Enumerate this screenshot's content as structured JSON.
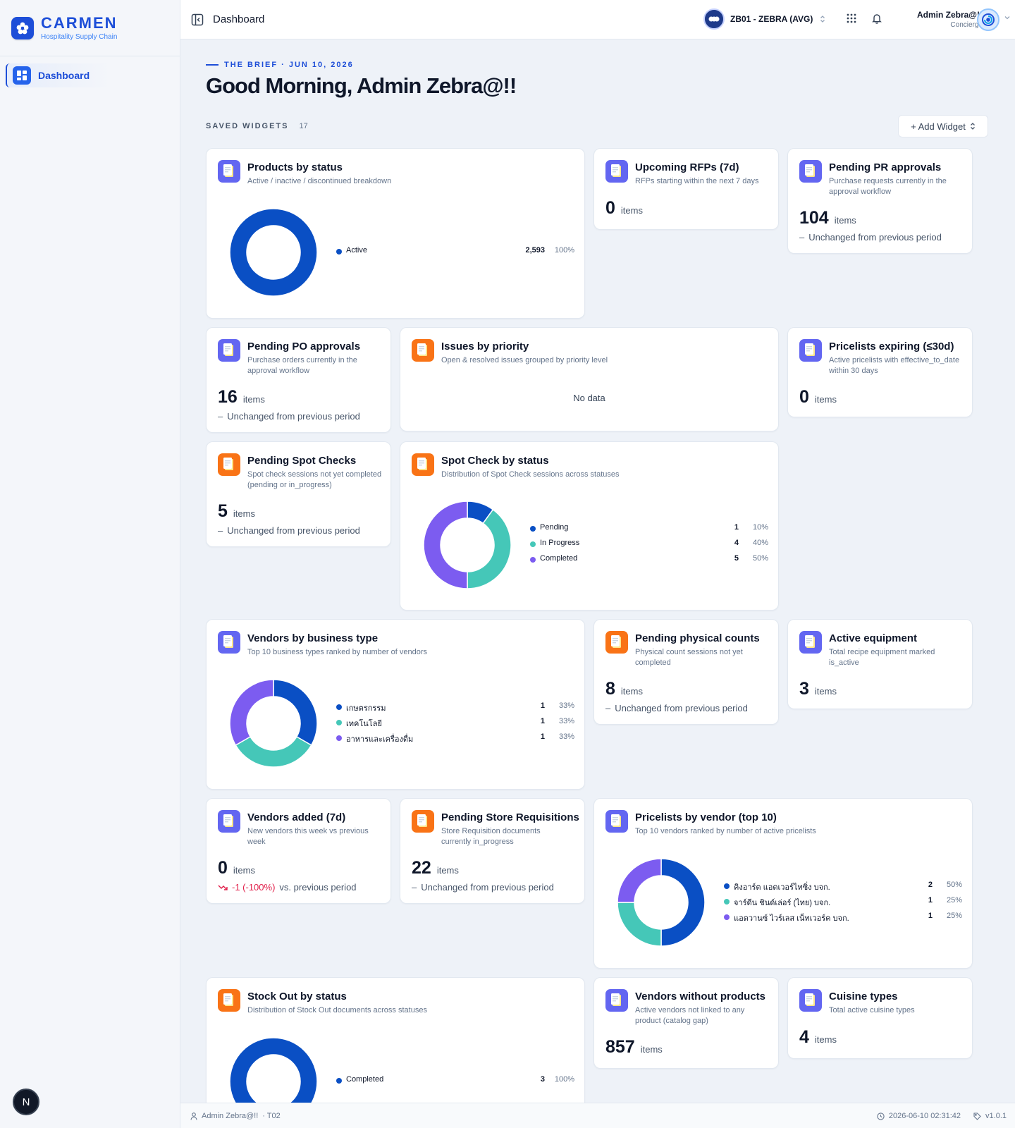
{
  "brand": {
    "name": "CARMEN",
    "subtitle": "Hospitality Supply Chain"
  },
  "sidebar": {
    "items": [
      {
        "label": "Dashboard",
        "icon": "dashboard-icon"
      }
    ]
  },
  "header": {
    "title": "Dashboard",
    "business_unit": "ZB01 - ZEBRA (AVG)",
    "user_name": "Admin Zebra@!!",
    "user_role": "Concierge"
  },
  "main": {
    "brief": "THE BRIEF · JUN 10, 2026",
    "greeting": "Good Morning, Admin Zebra@!!",
    "saved_label": "SAVED WIDGETS",
    "saved_count": "17",
    "add_widget": "+ Add Widget"
  },
  "colors": {
    "blue": "#0a4fc4",
    "teal": "#45c7b8",
    "purple": "#7c5cf0",
    "orange": "#f97316",
    "indigo": "#6366f1"
  },
  "widgets": {
    "products": {
      "title": "Products by status",
      "desc": "Active / inactive / discontinued breakdown",
      "legend": [
        {
          "label": "Active",
          "value": "2,593",
          "pct": "100%"
        }
      ]
    },
    "rfps": {
      "title": "Upcoming RFPs (7d)",
      "desc": "RFPs starting within the next 7 days",
      "value": "0",
      "unit": "items"
    },
    "pr": {
      "title": "Pending PR approvals",
      "desc": "Purchase requests currently in the approval workflow",
      "value": "104",
      "unit": "items",
      "trend": "Unchanged from previous period"
    },
    "po": {
      "title": "Pending PO approvals",
      "desc": "Purchase orders currently in the approval workflow",
      "value": "16",
      "unit": "items",
      "trend": "Unchanged from previous period"
    },
    "issues": {
      "title": "Issues by priority",
      "desc": "Open & resolved issues grouped by priority level",
      "empty": "No data"
    },
    "pricelists_exp": {
      "title": "Pricelists expiring (≤30d)",
      "desc": "Active pricelists with effective_to_date within 30 days",
      "value": "0",
      "unit": "items"
    },
    "spot_pending": {
      "title": "Pending Spot Checks",
      "desc": "Spot check sessions not yet completed (pending or in_progress)",
      "value": "5",
      "unit": "items",
      "trend": "Unchanged from previous period"
    },
    "spot_status": {
      "title": "Spot Check by status",
      "desc": "Distribution of Spot Check sessions across statuses",
      "legend": [
        {
          "label": "Pending",
          "value": "1",
          "pct": "10%"
        },
        {
          "label": "In Progress",
          "value": "4",
          "pct": "40%"
        },
        {
          "label": "Completed",
          "value": "5",
          "pct": "50%"
        }
      ]
    },
    "vendors_type": {
      "title": "Vendors by business type",
      "desc": "Top 10 business types ranked by number of vendors",
      "legend": [
        {
          "label": "เกษตรกรรม",
          "value": "1",
          "pct": "33%"
        },
        {
          "label": "เทคโนโลยี",
          "value": "1",
          "pct": "33%"
        },
        {
          "label": "อาหารและเครื่องดื่ม",
          "value": "1",
          "pct": "33%"
        }
      ]
    },
    "physical": {
      "title": "Pending physical counts",
      "desc": "Physical count sessions not yet completed",
      "value": "8",
      "unit": "items",
      "trend": "Unchanged from previous period"
    },
    "equipment": {
      "title": "Active equipment",
      "desc": "Total recipe equipment marked is_active",
      "value": "3",
      "unit": "items"
    },
    "vendors_added": {
      "title": "Vendors added (7d)",
      "desc": "New vendors this week vs previous week",
      "value": "0",
      "unit": "items",
      "trend_change": "-1 (-100%)",
      "trend_rest": "vs. previous period"
    },
    "store_req": {
      "title": "Pending Store Requisitions",
      "desc": "Store Requisition documents currently in_progress",
      "value": "22",
      "unit": "items",
      "trend": "Unchanged from previous period"
    },
    "pricelists_vendor": {
      "title": "Pricelists by vendor (top 10)",
      "desc": "Top 10 vendors ranked by number of active pricelists",
      "legend": [
        {
          "label": "คิงอาร์ต แอดเวอร์ไทซิ่ง บจก.",
          "value": "2",
          "pct": "50%"
        },
        {
          "label": "จาร์ดีน ชินด์เล่อร์ (ไทย) บจก.",
          "value": "1",
          "pct": "25%"
        },
        {
          "label": "แอดวานซ์ ไวร์เลส เน็ทเวอร์ค บจก.",
          "value": "1",
          "pct": "25%"
        }
      ]
    },
    "stock_out": {
      "title": "Stock Out by status",
      "desc": "Distribution of Stock Out documents across statuses",
      "legend": [
        {
          "label": "Completed",
          "value": "3",
          "pct": "100%"
        }
      ]
    },
    "vendors_noprod": {
      "title": "Vendors without products",
      "desc": "Active vendors not linked to any product (catalog gap)",
      "value": "857",
      "unit": "items"
    },
    "cuisine": {
      "title": "Cuisine types",
      "desc": "Total active cuisine types",
      "value": "4",
      "unit": "items"
    }
  },
  "chart_data": [
    {
      "type": "pie",
      "title": "Products by status",
      "categories": [
        "Active"
      ],
      "values": [
        2593
      ],
      "colors": [
        "#0a4fc4"
      ]
    },
    {
      "type": "pie",
      "title": "Spot Check by status",
      "categories": [
        "Pending",
        "In Progress",
        "Completed"
      ],
      "values": [
        1,
        4,
        5
      ],
      "colors": [
        "#0a4fc4",
        "#45c7b8",
        "#7c5cf0"
      ]
    },
    {
      "type": "pie",
      "title": "Vendors by business type",
      "categories": [
        "เกษตรกรรม",
        "เทคโนโลยี",
        "อาหารและเครื่องดื่ม"
      ],
      "values": [
        1,
        1,
        1
      ],
      "colors": [
        "#0a4fc4",
        "#45c7b8",
        "#7c5cf0"
      ]
    },
    {
      "type": "pie",
      "title": "Pricelists by vendor (top 10)",
      "categories": [
        "คิงอาร์ต แอดเวอร์ไทซิ่ง บจก.",
        "จาร์ดีน ชินด์เล่อร์ (ไทย) บจก.",
        "แอดวานซ์ ไวร์เลส เน็ทเวอร์ค บจก."
      ],
      "values": [
        2,
        1,
        1
      ],
      "colors": [
        "#0a4fc4",
        "#45c7b8",
        "#7c5cf0"
      ]
    },
    {
      "type": "pie",
      "title": "Stock Out by status",
      "categories": [
        "Completed"
      ],
      "values": [
        3
      ],
      "colors": [
        "#0a4fc4"
      ]
    }
  ],
  "footer": {
    "user": "Admin Zebra@!!",
    "tenant": "· T02",
    "timestamp": "2026-06-10 02:31:42",
    "version": "v1.0.1"
  }
}
